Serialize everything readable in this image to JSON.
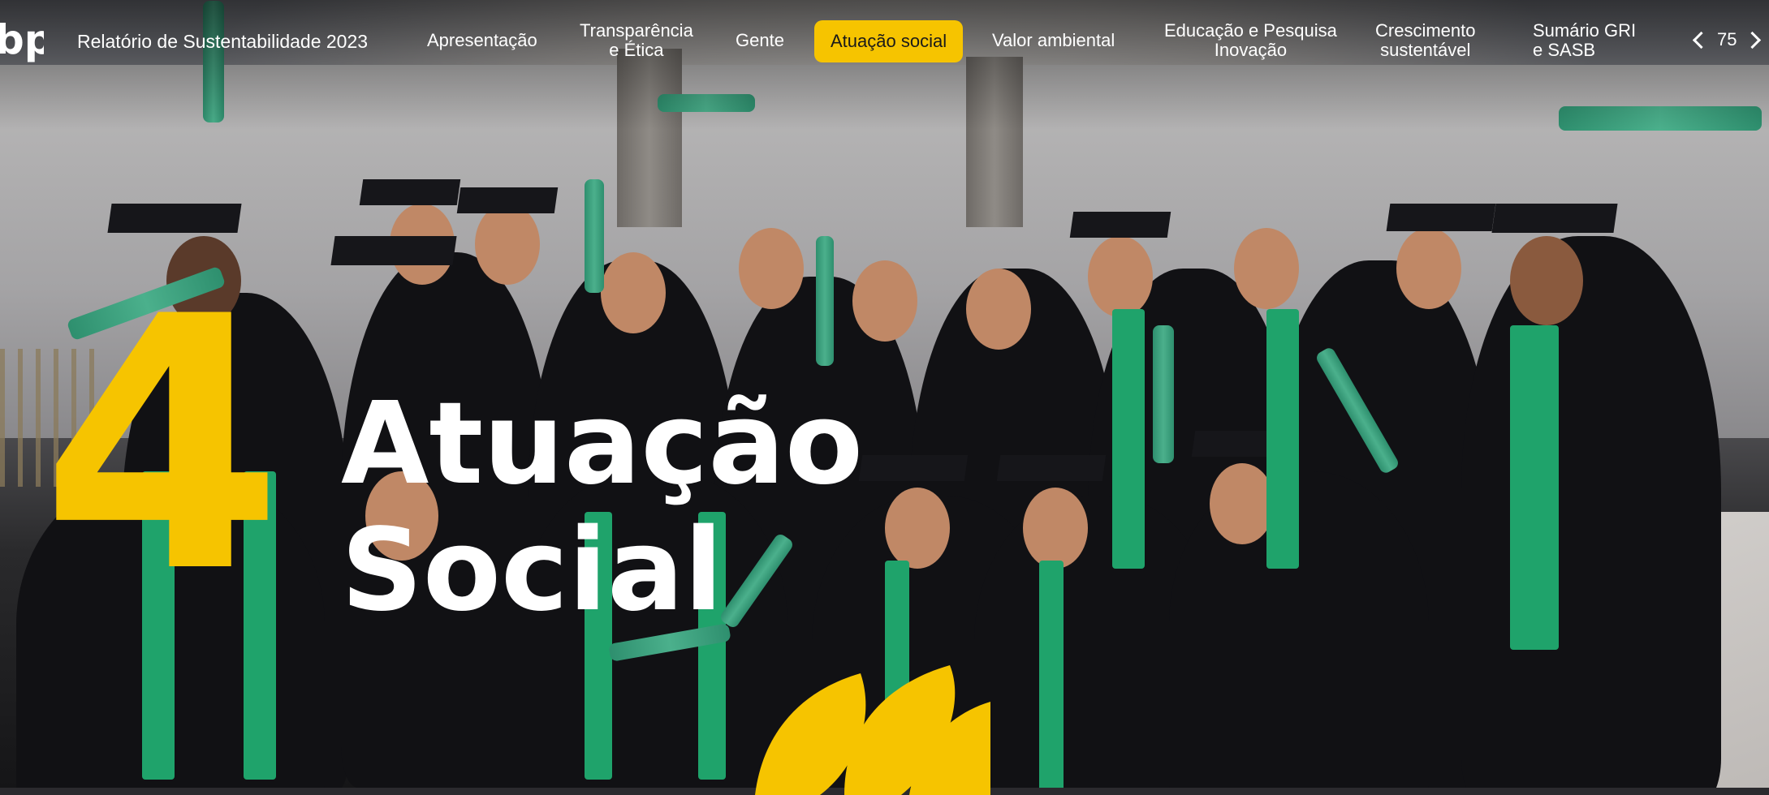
{
  "header": {
    "report_title": "Relatório de Sustentabilidade 2023",
    "logo": "bp",
    "nav": [
      {
        "line1": "Apresentação",
        "line2": ""
      },
      {
        "line1": "Transparência",
        "line2": "e Ética"
      },
      {
        "line1": "Gente",
        "line2": ""
      },
      {
        "line1": "Atuação social",
        "line2": "",
        "active": true
      },
      {
        "line1": "Valor ambiental",
        "line2": ""
      },
      {
        "line1": "Educação e Pesquisa",
        "line2": "Inovação"
      },
      {
        "line1": "Crescimento",
        "line2": "sustentável"
      },
      {
        "line1": "Sumário GRI",
        "line2": "e SASB"
      }
    ],
    "page_number": "75",
    "prev_icon": "chevron-left-icon",
    "next_icon": "chevron-right-icon"
  },
  "chapter": {
    "number": "4",
    "title_line1": "Atuação",
    "title_line2": "Social"
  },
  "colors": {
    "accent": "#f6c400",
    "stole_green": "#1fa36b",
    "text": "#ffffff"
  }
}
